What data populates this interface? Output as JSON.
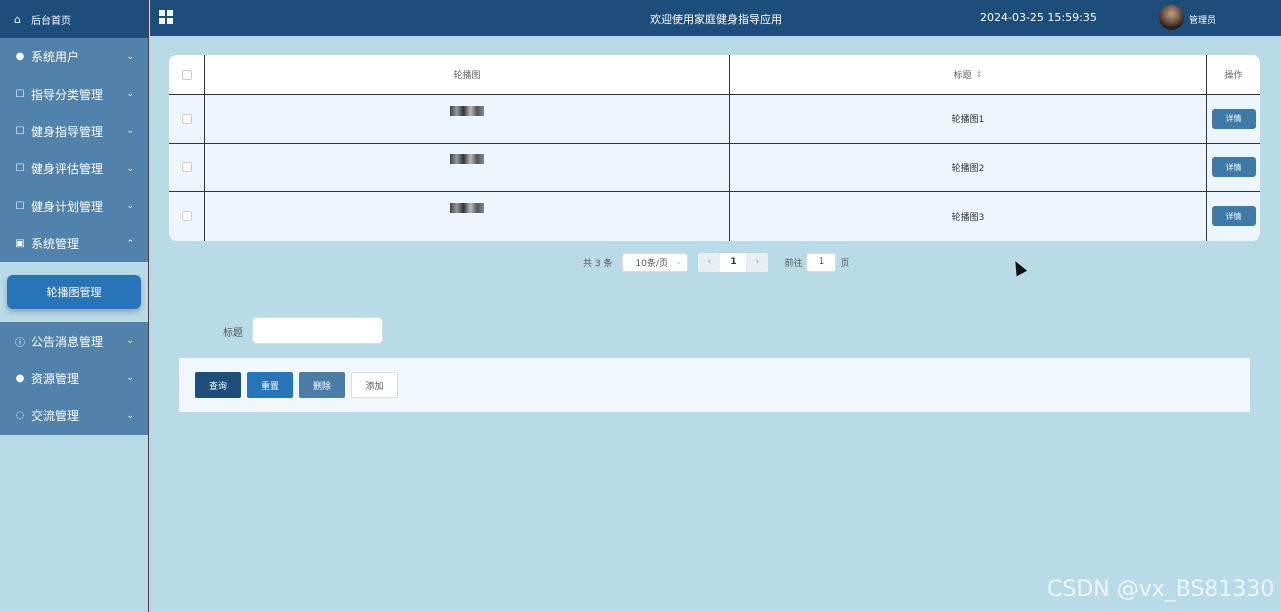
{
  "header": {
    "welcome": "欢迎使用家庭健身指导应用",
    "datetime": "2024-03-25 15:59:35",
    "user": "管理员"
  },
  "sidebar": {
    "home": {
      "label": "后台首页",
      "icon": "home-icon"
    },
    "items": [
      {
        "label": "系统用户",
        "icon": "user-icon",
        "expanded": false
      },
      {
        "label": "指导分类管理",
        "icon": "edit-icon",
        "expanded": false
      },
      {
        "label": "健身指导管理",
        "icon": "edit-icon",
        "expanded": false
      },
      {
        "label": "健身评估管理",
        "icon": "edit-icon",
        "expanded": false
      },
      {
        "label": "健身计划管理",
        "icon": "edit-icon",
        "expanded": false
      },
      {
        "label": "系统管理",
        "icon": "picture-icon",
        "expanded": true,
        "children": [
          "轮播图管理"
        ]
      },
      {
        "label": "公告消息管理",
        "icon": "info-icon",
        "expanded": false
      },
      {
        "label": "资源管理",
        "icon": "location-icon",
        "expanded": false
      },
      {
        "label": "交流管理",
        "icon": "chat-icon",
        "expanded": false
      }
    ]
  },
  "table": {
    "headers": {
      "image": "轮播图",
      "title": "标题",
      "actions": "操作"
    },
    "rows": [
      {
        "title": "轮播图1",
        "action": "详情"
      },
      {
        "title": "轮播图2",
        "action": "详情"
      },
      {
        "title": "轮播图3",
        "action": "详情"
      }
    ]
  },
  "pagination": {
    "total": "共 3 条",
    "page_size": "10条/页",
    "current_page": "1",
    "goto_label": "前往",
    "goto_value": "1",
    "page_unit": "页"
  },
  "search": {
    "label": "标题",
    "value": "",
    "placeholder": ""
  },
  "actions": {
    "query": "查询",
    "reset": "重置",
    "delete": "删除",
    "add": "添加"
  },
  "watermark": "CSDN @vx_BS81330",
  "colors": {
    "header_bg": "#1d4d7a",
    "sidebar_item_bg": "#5182ac",
    "page_bg": "#b8dbe7",
    "accent": "#2874b8"
  }
}
